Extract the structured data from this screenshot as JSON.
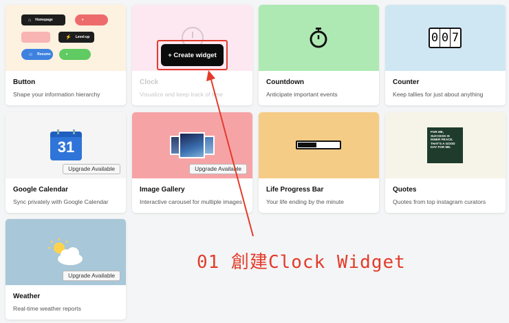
{
  "cards": [
    {
      "title": "Button",
      "desc": "Shape your information hierarchy",
      "bg": "#fdf1e0"
    },
    {
      "title": "Clock",
      "desc": "Visualize and keep track of time",
      "bg": "#fde8f2"
    },
    {
      "title": "Countdown",
      "desc": "Anticipate important events",
      "bg": "#aee9b3"
    },
    {
      "title": "Counter",
      "desc": "Keep tallies for just about anything",
      "bg": "#cfe7f3"
    },
    {
      "title": "Google Calendar",
      "desc": "Sync privately with Google Calendar",
      "bg": "#f5f5f5"
    },
    {
      "title": "Image Gallery",
      "desc": "Interactive carousel for multiple images",
      "bg": "#f6a3a6"
    },
    {
      "title": "Life Progress Bar",
      "desc": "Your life ending by the minute",
      "bg": "#f5cc86"
    },
    {
      "title": "Quotes",
      "desc": "Quotes from top instagram curators",
      "bg": "#f6f4e8"
    },
    {
      "title": "Weather",
      "desc": "Real-time weather reports",
      "bg": "#a8c7d8"
    }
  ],
  "button_preview": {
    "homepage": "Homepage",
    "levelup": "Level-up",
    "resume": "Resume"
  },
  "counter_digits": [
    "0",
    "0",
    "7"
  ],
  "calendar_day": "31",
  "quote_text": "FOR ME, SUCCESS IS INNER PEACE. THAT'S A GOOD DAY FOR ME.",
  "upgrade_label": "Upgrade Available",
  "create_widget_label": "+ Create widget",
  "annotation_text": "01 創建Clock Widget",
  "colors": {
    "annotation": "#e23b2a",
    "card_bg": "#ffffff",
    "page_bg": "#f4f5f6"
  }
}
